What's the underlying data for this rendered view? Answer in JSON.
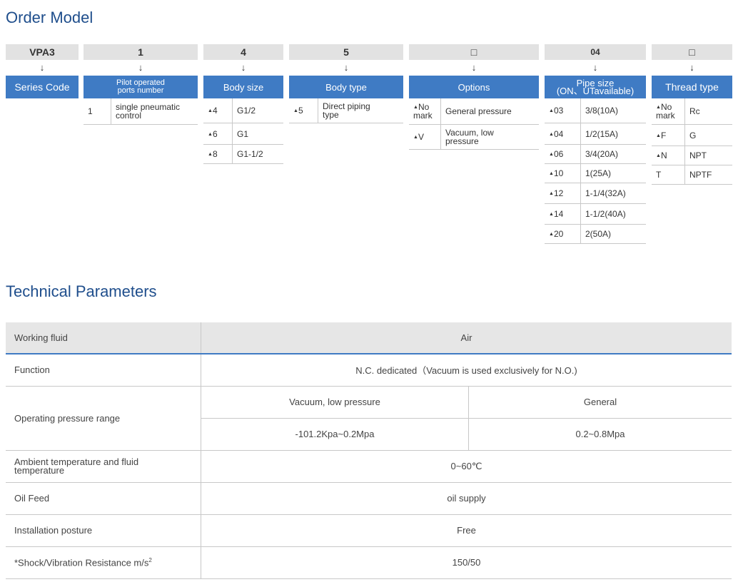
{
  "order_model": {
    "title": "Order Model",
    "arrow": "↓",
    "series": {
      "code": "VPA3",
      "header": "Series Code"
    },
    "pilot": {
      "code": "1",
      "header_line1": "Pilot operated",
      "header_line2": "ports number",
      "rows": [
        {
          "k": "1",
          "v1": "single pneumatic",
          "v2": "control"
        }
      ]
    },
    "body_size": {
      "code": "4",
      "header": "Body size",
      "rows": [
        {
          "k": "4",
          "v": "G1/2"
        },
        {
          "k": "6",
          "v": "G1"
        },
        {
          "k": "8",
          "v": "G1-1/2"
        }
      ]
    },
    "body_type": {
      "code": "5",
      "header": "Body type",
      "rows": [
        {
          "k": "5",
          "v1": "Direct piping",
          "v2": "type"
        }
      ]
    },
    "options": {
      "code": "□",
      "header": "Options",
      "rows": [
        {
          "k1": "No",
          "k2": "mark",
          "v1": "General pressure",
          "v2": ""
        },
        {
          "k1": "V",
          "k2": "",
          "v1": "Vacuum, low",
          "v2": "pressure"
        }
      ]
    },
    "pipe_size": {
      "code": "04",
      "header_line1": "Pipe size",
      "header_line2": "(ON、UTavailable)",
      "rows": [
        {
          "k": "03",
          "v": "3/8(10A)"
        },
        {
          "k": "04",
          "v": "1/2(15A)"
        },
        {
          "k": "06",
          "v": "3/4(20A)"
        },
        {
          "k": "10",
          "v": "1(25A)"
        },
        {
          "k": "12",
          "v": "1-1/4(32A)"
        },
        {
          "k": "14",
          "v": "1-1/2(40A)"
        },
        {
          "k": "20",
          "v": "2(50A)"
        }
      ]
    },
    "thread": {
      "code": "□",
      "header": "Thread type",
      "rows": [
        {
          "k1": "No",
          "k2": "mark",
          "v": "Rc"
        },
        {
          "k1": "F",
          "k2": "",
          "v": "G"
        },
        {
          "k1": "N",
          "k2": "",
          "v": "NPT"
        },
        {
          "k1": "T",
          "k2": "",
          "v": "NPTF"
        }
      ]
    },
    "triangle": "▲"
  },
  "technical": {
    "title": "Technical Parameters",
    "working_fluid": {
      "label": "Working fluid",
      "value": "Air"
    },
    "function": {
      "label": "Function",
      "value": "N.C. dedicated（Vacuum is used exclusively for N.O.)"
    },
    "operating_pressure": {
      "label": "Operating pressure range",
      "sub1_label": "Vacuum, low pressure",
      "sub2_label": "General",
      "sub1_value": "-101.2Kpa~0.2Mpa",
      "sub2_value": "0.2~0.8Mpa"
    },
    "ambient": {
      "label_line1": "Ambient temperature and fluid",
      "label_line2": "temperature",
      "value": "0~60℃"
    },
    "oil_feed": {
      "label": "Oil Feed",
      "value": "oil supply"
    },
    "installation": {
      "label": "Installation posture",
      "value": "Free"
    },
    "shock": {
      "label": "*Shock/Vibration Resistance m/s",
      "sup": "2",
      "value": "150/50"
    }
  }
}
